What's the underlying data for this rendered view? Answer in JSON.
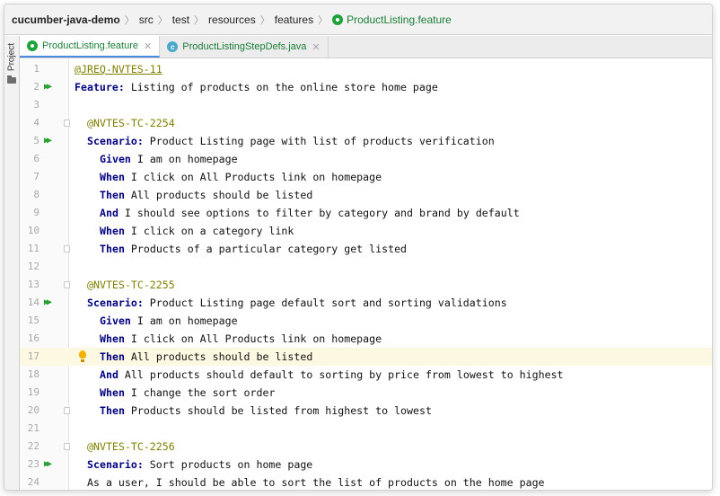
{
  "breadcrumb": {
    "project": "cucumber-java-demo",
    "items": [
      "src",
      "test",
      "resources",
      "features"
    ],
    "file": "ProductListing.feature"
  },
  "toolwindow": {
    "project_label": "Project"
  },
  "tabs": [
    {
      "label": "ProductListing.feature",
      "icon": "gherkin-icon",
      "active": true
    },
    {
      "label": "ProductListingStepDefs.java",
      "icon": "java-class-icon",
      "active": false
    }
  ],
  "editor": {
    "current_line": 17,
    "colors": {
      "keyword": "#000080",
      "tag": "#808000",
      "line_number": "#a9a9a9",
      "current_line_bg": "#fdf8e1"
    },
    "lines": [
      {
        "num": "1",
        "tag": "@JREQ-NVTES-11"
      },
      {
        "num": "2",
        "keyword": "Feature:",
        "text": " Listing of products on the online store home page"
      },
      {
        "num": "3"
      },
      {
        "num": "4",
        "tag": "@NVTES-TC-2254"
      },
      {
        "num": "5",
        "keyword": "Scenario:",
        "text": " Product Listing page with list of products verification"
      },
      {
        "num": "6",
        "keyword": "Given",
        "text": " I am on homepage"
      },
      {
        "num": "7",
        "keyword": "When",
        "text": " I click on All Products link on homepage"
      },
      {
        "num": "8",
        "keyword": "Then",
        "text": " All products should be listed"
      },
      {
        "num": "9",
        "keyword": "And",
        "text": " I should see options to filter by category and brand by default"
      },
      {
        "num": "10",
        "keyword": "When",
        "text": " I click on a category link"
      },
      {
        "num": "11",
        "keyword": "Then",
        "text": " Products of a particular category get listed"
      },
      {
        "num": "12"
      },
      {
        "num": "13",
        "tag": "@NVTES-TC-2255"
      },
      {
        "num": "14",
        "keyword": "Scenario:",
        "text": " Product Listing page default sort and sorting validations"
      },
      {
        "num": "15",
        "keyword": "Given",
        "text": " I am on homepage"
      },
      {
        "num": "16",
        "keyword": "When",
        "text": " I click on All Products link on homepage"
      },
      {
        "num": "17",
        "keyword": "Then",
        "text": " All products should be listed"
      },
      {
        "num": "18",
        "keyword": "And",
        "text": " All products should default to sorting by price from lowest to highest"
      },
      {
        "num": "19",
        "keyword": "When",
        "text": " I change the sort order"
      },
      {
        "num": "20",
        "keyword": "Then",
        "text": " Products should be listed from highest to lowest"
      },
      {
        "num": "21"
      },
      {
        "num": "22",
        "tag": "@NVTES-TC-2256"
      },
      {
        "num": "23",
        "keyword": "Scenario:",
        "text": " Sort products on home page"
      },
      {
        "num": "24",
        "text": "As a user, I should be able to sort the list of products on the home page"
      }
    ]
  }
}
